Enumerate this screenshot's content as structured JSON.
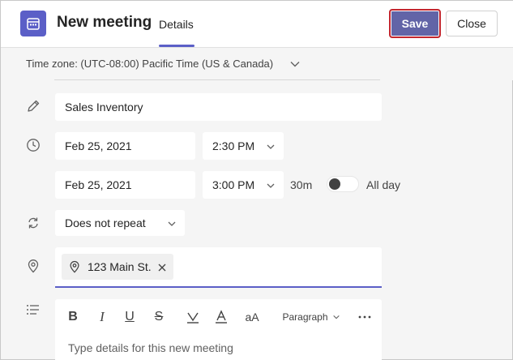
{
  "header": {
    "title": "New meeting",
    "tab_label": "Details",
    "save_label": "Save",
    "close_label": "Close",
    "accent_color": "#5b5fc7",
    "save_color": "#6264a7",
    "save_focus_color": "#c4262e"
  },
  "timezone": {
    "label": "Time zone: (UTC-08:00) Pacific Time (US & Canada)"
  },
  "form": {
    "title_value": "Sales Inventory",
    "start_date": "Feb 25, 2021",
    "start_time": "2:30 PM",
    "end_date": "Feb 25, 2021",
    "end_time": "3:00 PM",
    "duration": "30m",
    "all_day_label": "All day",
    "all_day_on": false,
    "repeat_value": "Does not repeat",
    "location_chip": "123 Main St.",
    "paragraph_style": "Paragraph",
    "font_size_label": "aA",
    "details_placeholder": "Type details for this new meeting"
  },
  "icons": {
    "app": "calendar-icon",
    "title": "pencil-icon",
    "time": "clock-icon",
    "repeat": "repeat-icon",
    "location": "location-pin-icon",
    "details": "list-icon"
  }
}
